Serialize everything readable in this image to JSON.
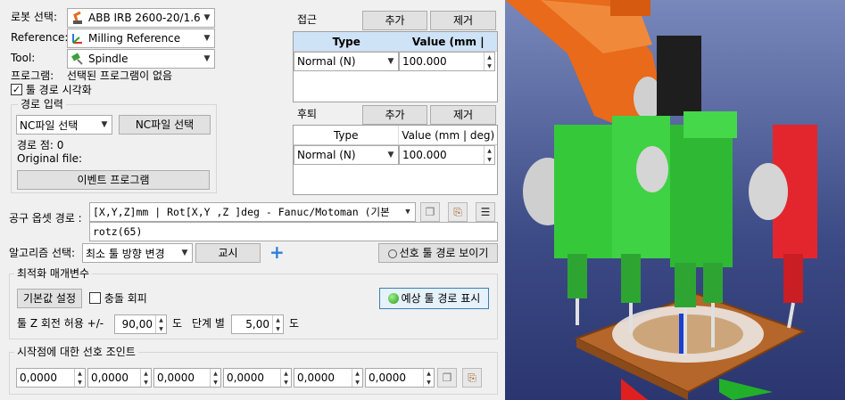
{
  "robot": {
    "label": "로봇 선택:",
    "value": "ABB IRB 2600-20/1.65"
  },
  "reference": {
    "label": "Reference:",
    "value": "Milling Reference"
  },
  "tool": {
    "label": "Tool:",
    "value": "Spindle"
  },
  "program": {
    "label": "프로그램:",
    "value": "선택된 프로그램이 없음"
  },
  "visualize_path": {
    "label": "툴 경로 시각화",
    "checked": true
  },
  "path_input": {
    "title": "경로 입력",
    "nc_combo": "NC파일 선택",
    "nc_button": "NC파일 선택",
    "points": "경로 점: 0",
    "original_file": "Original file:",
    "event_button": "이벤트 프로그램"
  },
  "approach": {
    "title": "접근",
    "add": "추가",
    "remove": "제거",
    "col_type": "Type",
    "col_value": "Value (mm | deg)",
    "row_type": "Normal (N)",
    "row_value": "100.000"
  },
  "retract": {
    "title": "후퇴",
    "add": "추가",
    "remove": "제거",
    "col_type": "Type",
    "col_value": "Value (mm | deg)",
    "row_type": "Normal (N)",
    "row_value": "100.000"
  },
  "tool_offset": {
    "label": "공구 옵셋 경로 :",
    "format": "[X,Y,Z]mm | Rot[X,Y ,Z  ]deg - Fanuc/Motoman (기본",
    "value": "rotz(65)"
  },
  "algorithm": {
    "label": "알고리즘 선택:",
    "value": "최소 툴 방향 변경",
    "teach_button": "교시",
    "add_icon": "+",
    "preferred_path_button": "선호 툴 경로 보이기"
  },
  "optimization": {
    "title": "최적화 매개변수",
    "defaults_button": "기본값 설정",
    "collision_label": "충돌 회피",
    "collision_checked": false,
    "expected_path_button": "예상 툴 경로 표시",
    "z_rotation_label": "툴 Z 회전 허용 +/-",
    "z_rotation_value": "90,00",
    "unit1": "도",
    "step_label": "단계 별",
    "step_value": "5,00",
    "unit2": "도"
  },
  "start_joints": {
    "title": "시작점에 대한 선호 조인트",
    "values": [
      "0,0000",
      "0,0000",
      "0,0000",
      "0,0000",
      "0,0000",
      "0,0000"
    ]
  },
  "colors": {
    "robot_orange": "#e86a1a",
    "spindle_green": "#3ccf3c",
    "spindle_red": "#e3262d",
    "header_blue": "#cfe3f7"
  }
}
